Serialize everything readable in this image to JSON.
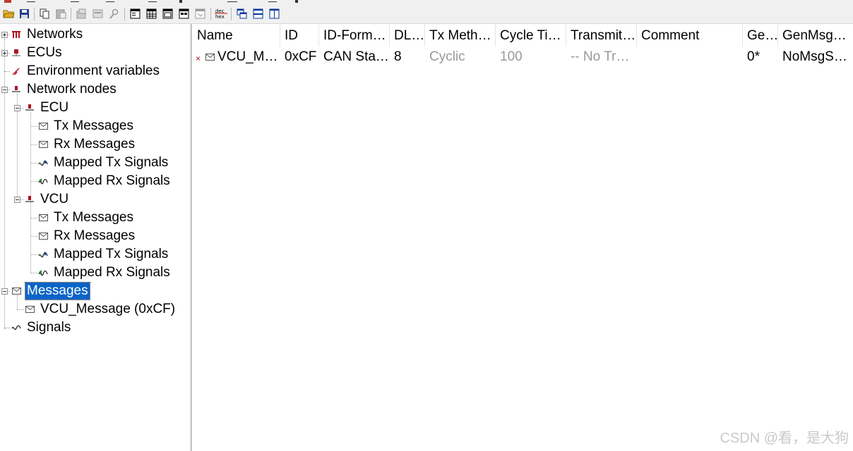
{
  "tree": {
    "networks": "Networks",
    "ecus": "ECUs",
    "environment_variables": "Environment variables",
    "network_nodes": "Network nodes",
    "ecu_node": {
      "name": "ECU",
      "tx_messages": "Tx Messages",
      "rx_messages": "Rx Messages",
      "mapped_tx_signals": "Mapped Tx Signals",
      "mapped_rx_signals": "Mapped Rx Signals"
    },
    "vcu_node": {
      "name": "VCU",
      "tx_messages": "Tx Messages",
      "rx_messages": "Rx Messages",
      "mapped_tx_signals": "Mapped Tx Signals",
      "mapped_rx_signals": "Mapped Rx Signals"
    },
    "messages": "Messages",
    "vcu_message": "VCU_Message (0xCF)",
    "signals": "Signals"
  },
  "table": {
    "headers": [
      "Name",
      "ID",
      "ID-Form…",
      "DL…",
      "Tx Meth…",
      "Cycle Ti…",
      "Transmit…",
      "Comment",
      "Ge…",
      "GenMsg…"
    ],
    "row": {
      "name": "VCU_M…",
      "id": "0xCF",
      "id_format": "CAN Sta…",
      "dlc": "8",
      "tx_method": "Cyclic",
      "cycle_time": "100",
      "transmitter": "-- No Tr…",
      "comment": "",
      "ge": "0*",
      "gen_msg": "NoMsgS…"
    }
  },
  "watermark": "CSDN @看，是大狗",
  "colors": {
    "selection": "#0a64c8",
    "toolbar_bg": "#f0f0f0",
    "gray_text": "#9a9a9a"
  }
}
